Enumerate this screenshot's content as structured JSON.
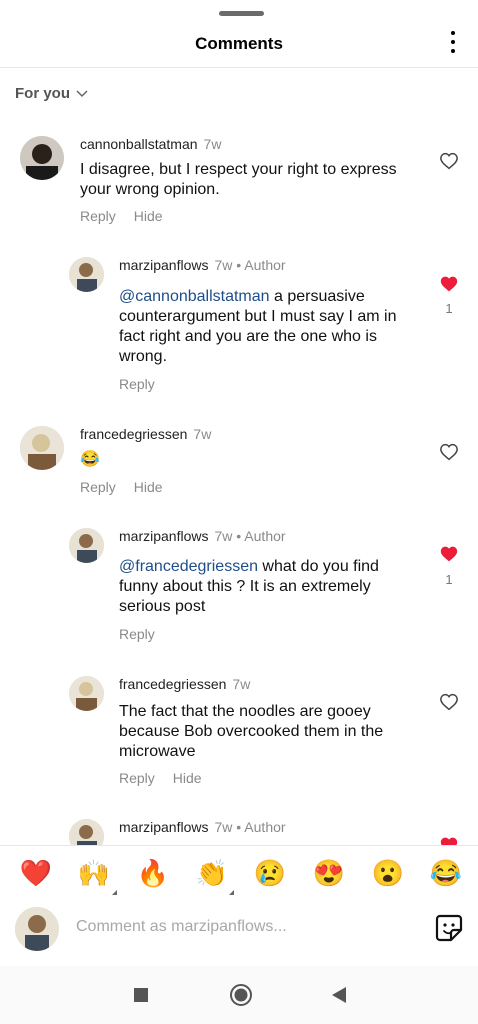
{
  "header": {
    "title": "Comments"
  },
  "sort": {
    "label": "For you"
  },
  "comments": [
    {
      "username": "cannonballstatman",
      "time": "7w",
      "text": "I disagree, but I respect your right to express your wrong opinion.",
      "actions": [
        "Reply",
        "Hide"
      ],
      "liked": false,
      "likes": ""
    },
    {
      "username": "marzipanflows",
      "time": "7w",
      "author": "• Author",
      "mention": "@cannonballstatman",
      "text": " a persuasive counterargument but I must say I am in fact right and you are the one who is wrong.",
      "actions": [
        "Reply"
      ],
      "liked": true,
      "likes": "1"
    },
    {
      "username": "francedegriessen",
      "time": "7w",
      "text": "😂",
      "actions": [
        "Reply",
        "Hide"
      ],
      "liked": false,
      "likes": ""
    },
    {
      "username": "marzipanflows",
      "time": "7w",
      "author": "• Author",
      "mention": "@francedegriessen",
      "text": " what do you find funny about this ? It is an extremely serious post",
      "actions": [
        "Reply"
      ],
      "liked": true,
      "likes": "1"
    },
    {
      "username": "francedegriessen",
      "time": "7w",
      "text": "The fact that the noodles are gooey because Bob overcooked them in the microwave",
      "actions": [
        "Reply",
        "Hide"
      ],
      "liked": false,
      "likes": ""
    },
    {
      "username": "marzipanflows",
      "time": "7w",
      "author": "• Author",
      "liked": true
    }
  ],
  "emoji_bar": [
    "❤️",
    "🙌",
    "🔥",
    "👏",
    "😢",
    "😍",
    "😮",
    "😂"
  ],
  "composer": {
    "placeholder": "Comment as marzipanflows..."
  },
  "colors": {
    "like_red": "#ed1c3a",
    "mention_blue": "#1f4e8b",
    "muted_gray": "#8a8a8a"
  },
  "icons": [
    "more-vertical-icon",
    "chevron-down-icon",
    "heart-outline-icon",
    "heart-filled-icon",
    "sticker-icon",
    "square-nav-icon",
    "circle-nav-icon",
    "back-triangle-icon"
  ]
}
